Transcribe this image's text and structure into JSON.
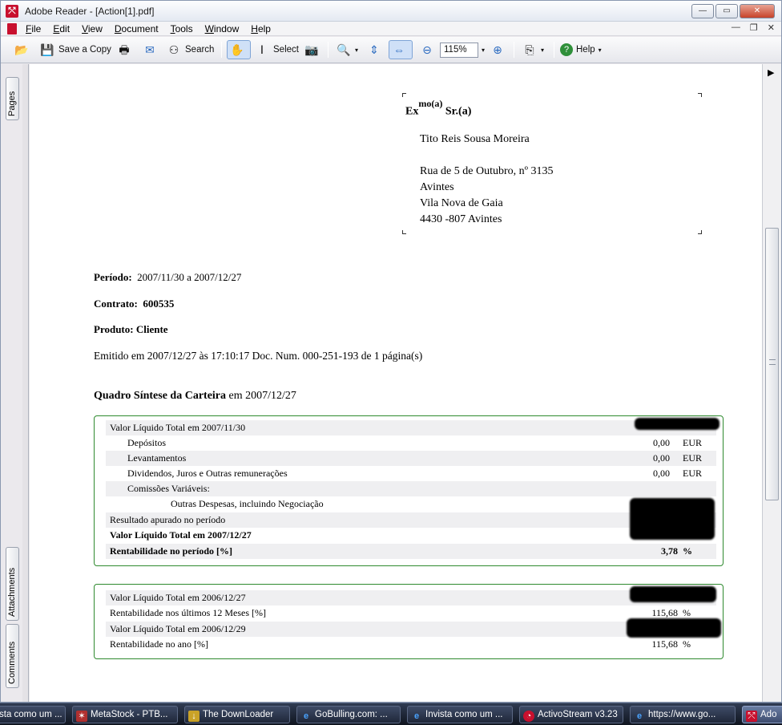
{
  "window": {
    "title": "Adobe Reader - [Action[1].pdf]"
  },
  "menu": [
    "File",
    "Edit",
    "View",
    "Document",
    "Tools",
    "Window",
    "Help"
  ],
  "toolbar": {
    "save_copy": "Save a Copy",
    "search": "Search",
    "select": "Select",
    "zoom": "115%",
    "help": "Help"
  },
  "side_tabs": {
    "pages": "Pages",
    "attachments": "Attachments",
    "comments": "Comments"
  },
  "document": {
    "salutation_prefix": "Ex",
    "salutation_sup": "mo(a)",
    "salutation_suffix": "Sr.(a)",
    "address": [
      "Tito Reis Sousa Moreira",
      "Rua de 5 de Outubro, nº 3135",
      "Avintes",
      "Vila Nova de Gaia",
      "4430 -807 Avintes"
    ],
    "periodo_label": "Período:",
    "periodo_value": "2007/11/30 a 2007/12/27",
    "contrato_label": "Contrato:",
    "contrato_value": "600535",
    "produto": "Produto: Cliente",
    "emitido": "Emitido em 2007/12/27 às 17:10:17   Doc. Num. 000-251-193 de 1 página(s)",
    "section_title_bold": "Quadro Síntese da Carteira",
    "section_title_rest": " em  2007/12/27",
    "box1": [
      {
        "label": "Valor Líquido Total em 2007/11/30",
        "value": "",
        "cur": ""
      },
      {
        "label": "Depósitos",
        "value": "0,00",
        "cur": "EUR"
      },
      {
        "label": "Levantamentos",
        "value": "0,00",
        "cur": "EUR"
      },
      {
        "label": "Dividendos, Juros e Outras remunerações",
        "value": "0,00",
        "cur": "EUR"
      },
      {
        "label": "Comissões Variáveis:",
        "value": "",
        "cur": ""
      },
      {
        "label": "Outras Despesas, incluindo Negociação",
        "value": "",
        "cur": ""
      },
      {
        "label": "Resultado apurado no período",
        "value": "",
        "cur": ""
      },
      {
        "label": "Valor Líquido Total em 2007/12/27",
        "value": "",
        "cur": ""
      },
      {
        "label": "Rentabilidade no período [%]",
        "value": "3,78",
        "cur": "%"
      }
    ],
    "box2": [
      {
        "label": "Valor Líquido Total em 2006/12/27",
        "value": "",
        "cur": ""
      },
      {
        "label": "Rentabilidade nos últimos 12 Meses [%]",
        "value": "115,68",
        "cur": "%"
      },
      {
        "label": "Valor Líquido Total em 2006/12/29",
        "value": "",
        "cur": ""
      },
      {
        "label": "Rentabilidade no ano [%]",
        "value": "115,68",
        "cur": "%"
      }
    ]
  },
  "taskbar": [
    "sta como um ...",
    "MetaStock - PTB...",
    "The DownLoader",
    "GoBulling.com: ...",
    "Invista como um ...",
    "ActivoStream v3.23",
    "https://www.go...",
    "Ado"
  ]
}
